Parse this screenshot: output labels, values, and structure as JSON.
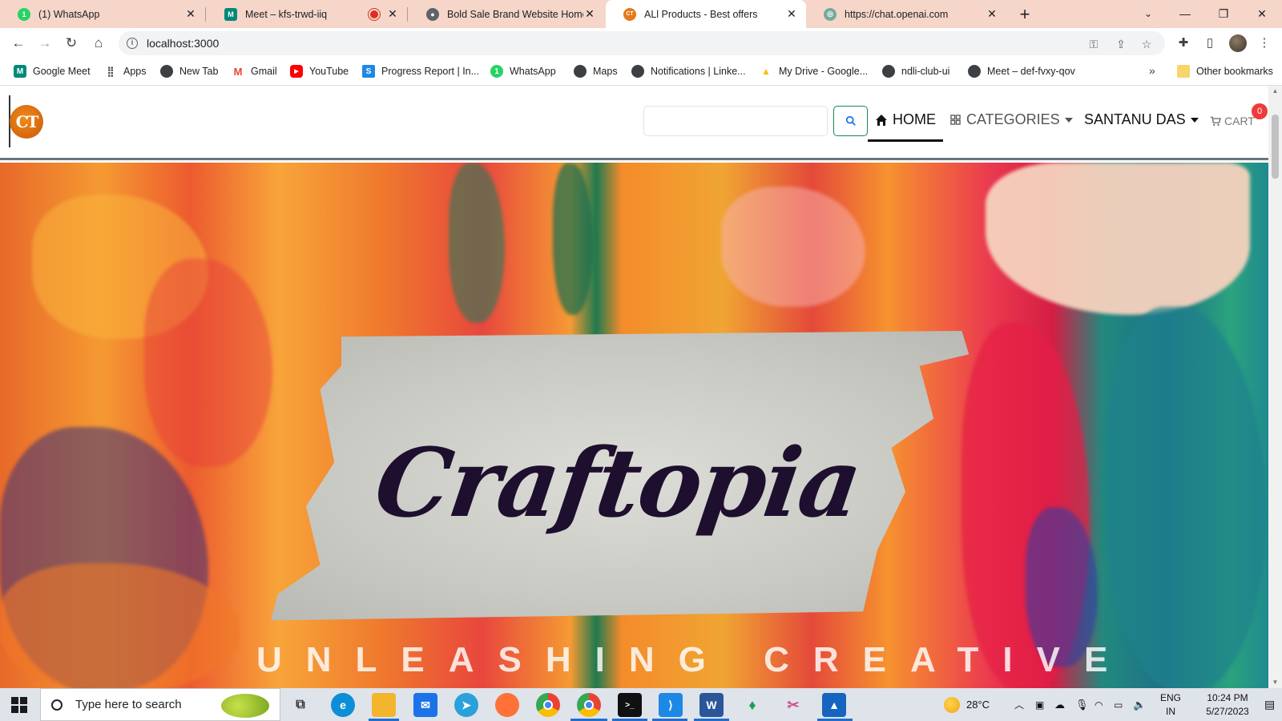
{
  "browser": {
    "tabs": [
      {
        "title": "(1) WhatsApp",
        "icon": "whatsapp-icon",
        "color": "#25d366",
        "glyph": "1"
      },
      {
        "title": "Meet – kfs-trwd-iiq",
        "icon": "google-meet-icon",
        "color": "#00897b",
        "glyph": "M"
      },
      {
        "title": "Bold Sale Brand Website Homep",
        "icon": "globe-icon",
        "color": "#5f6368",
        "glyph": "●"
      },
      {
        "title": "ALl Products - Best offers",
        "icon": "craftopia-logo-icon",
        "color": "#e57a1a",
        "glyph": "CT"
      },
      {
        "title": "https://chat.openai.com",
        "icon": "openai-icon",
        "color": "#74aa9c",
        "glyph": "◎"
      }
    ],
    "url": "localhost:3000",
    "bookmarks": [
      {
        "label": "Google Meet",
        "icon": "google-meet-icon",
        "color": "#00897b",
        "glyph": "M"
      },
      {
        "label": "Apps",
        "icon": "apps-grid-icon",
        "color": "#3c4043",
        "glyph": "⋮⋮"
      },
      {
        "label": "New Tab",
        "icon": "globe-icon",
        "color": "#3c4043",
        "glyph": "●"
      },
      {
        "label": "Gmail",
        "icon": "gmail-icon",
        "color": "#ea4335",
        "glyph": "M"
      },
      {
        "label": "YouTube",
        "icon": "youtube-icon",
        "color": "#ff0000",
        "glyph": "▶"
      },
      {
        "label": "Progress Report | In...",
        "icon": "progress-report-icon",
        "color": "#1e88e5",
        "glyph": "S"
      },
      {
        "label": "WhatsApp",
        "icon": "whatsapp-icon",
        "color": "#25d366",
        "glyph": "1"
      },
      {
        "label": "Maps",
        "icon": "globe-icon",
        "color": "#3c4043",
        "glyph": "●"
      },
      {
        "label": "Notifications | Linke...",
        "icon": "globe-icon",
        "color": "#3c4043",
        "glyph": "●"
      },
      {
        "label": "My Drive - Google...",
        "icon": "google-drive-icon",
        "color": "#fbbc04",
        "glyph": "▲"
      },
      {
        "label": "ndli-club-ui",
        "icon": "globe-icon",
        "color": "#3c4043",
        "glyph": "●"
      },
      {
        "label": "Meet – def-fvxy-qov",
        "icon": "globe-icon",
        "color": "#3c4043",
        "glyph": "●"
      }
    ],
    "other_bookmarks": "Other bookmarks",
    "more": "»"
  },
  "site": {
    "logo_text": "CT",
    "nav": {
      "home": "HOME",
      "categories": "CATEGORIES",
      "user": "SANTANU DAS",
      "cart": "CART",
      "cart_count": "0"
    },
    "hero": {
      "title": "Craftopia",
      "subtitle": "UNLEASHING CREATIVE"
    }
  },
  "taskbar": {
    "search_placeholder": "Type here to search",
    "weather": "28°C",
    "lang_1": "ENG",
    "lang_2": "IN",
    "time": "10:24 PM",
    "date": "5/27/2023",
    "apps": [
      {
        "name": "task-view-icon",
        "glyph": "⧉",
        "color": "#333"
      },
      {
        "name": "edge-icon",
        "glyph": "e",
        "color": "#0c8fd6"
      },
      {
        "name": "file-explorer-icon",
        "glyph": "▬",
        "color": "#f2b52c"
      },
      {
        "name": "mail-icon",
        "glyph": "✉",
        "color": "#1a73e8"
      },
      {
        "name": "telegram-icon",
        "glyph": "➤",
        "color": "#2aa1da"
      },
      {
        "name": "firefox-icon",
        "glyph": "●",
        "color": "#ff7139"
      },
      {
        "name": "chrome-icon",
        "glyph": "◉",
        "color": "#34a853"
      },
      {
        "name": "chrome-profile-icon",
        "glyph": "◉",
        "color": "#ea4335"
      },
      {
        "name": "terminal-icon",
        "glyph": ">_",
        "color": "#111"
      },
      {
        "name": "vscode-icon",
        "glyph": "⟩",
        "color": "#1e88e5"
      },
      {
        "name": "word-icon",
        "glyph": "W",
        "color": "#2b579a"
      },
      {
        "name": "mongodb-compass-icon",
        "glyph": "♦",
        "color": "#1f9d55"
      },
      {
        "name": "snip-tool-icon",
        "glyph": "✂",
        "color": "#d04f8e"
      },
      {
        "name": "photos-icon",
        "glyph": "▲",
        "color": "#1565c0"
      }
    ]
  }
}
